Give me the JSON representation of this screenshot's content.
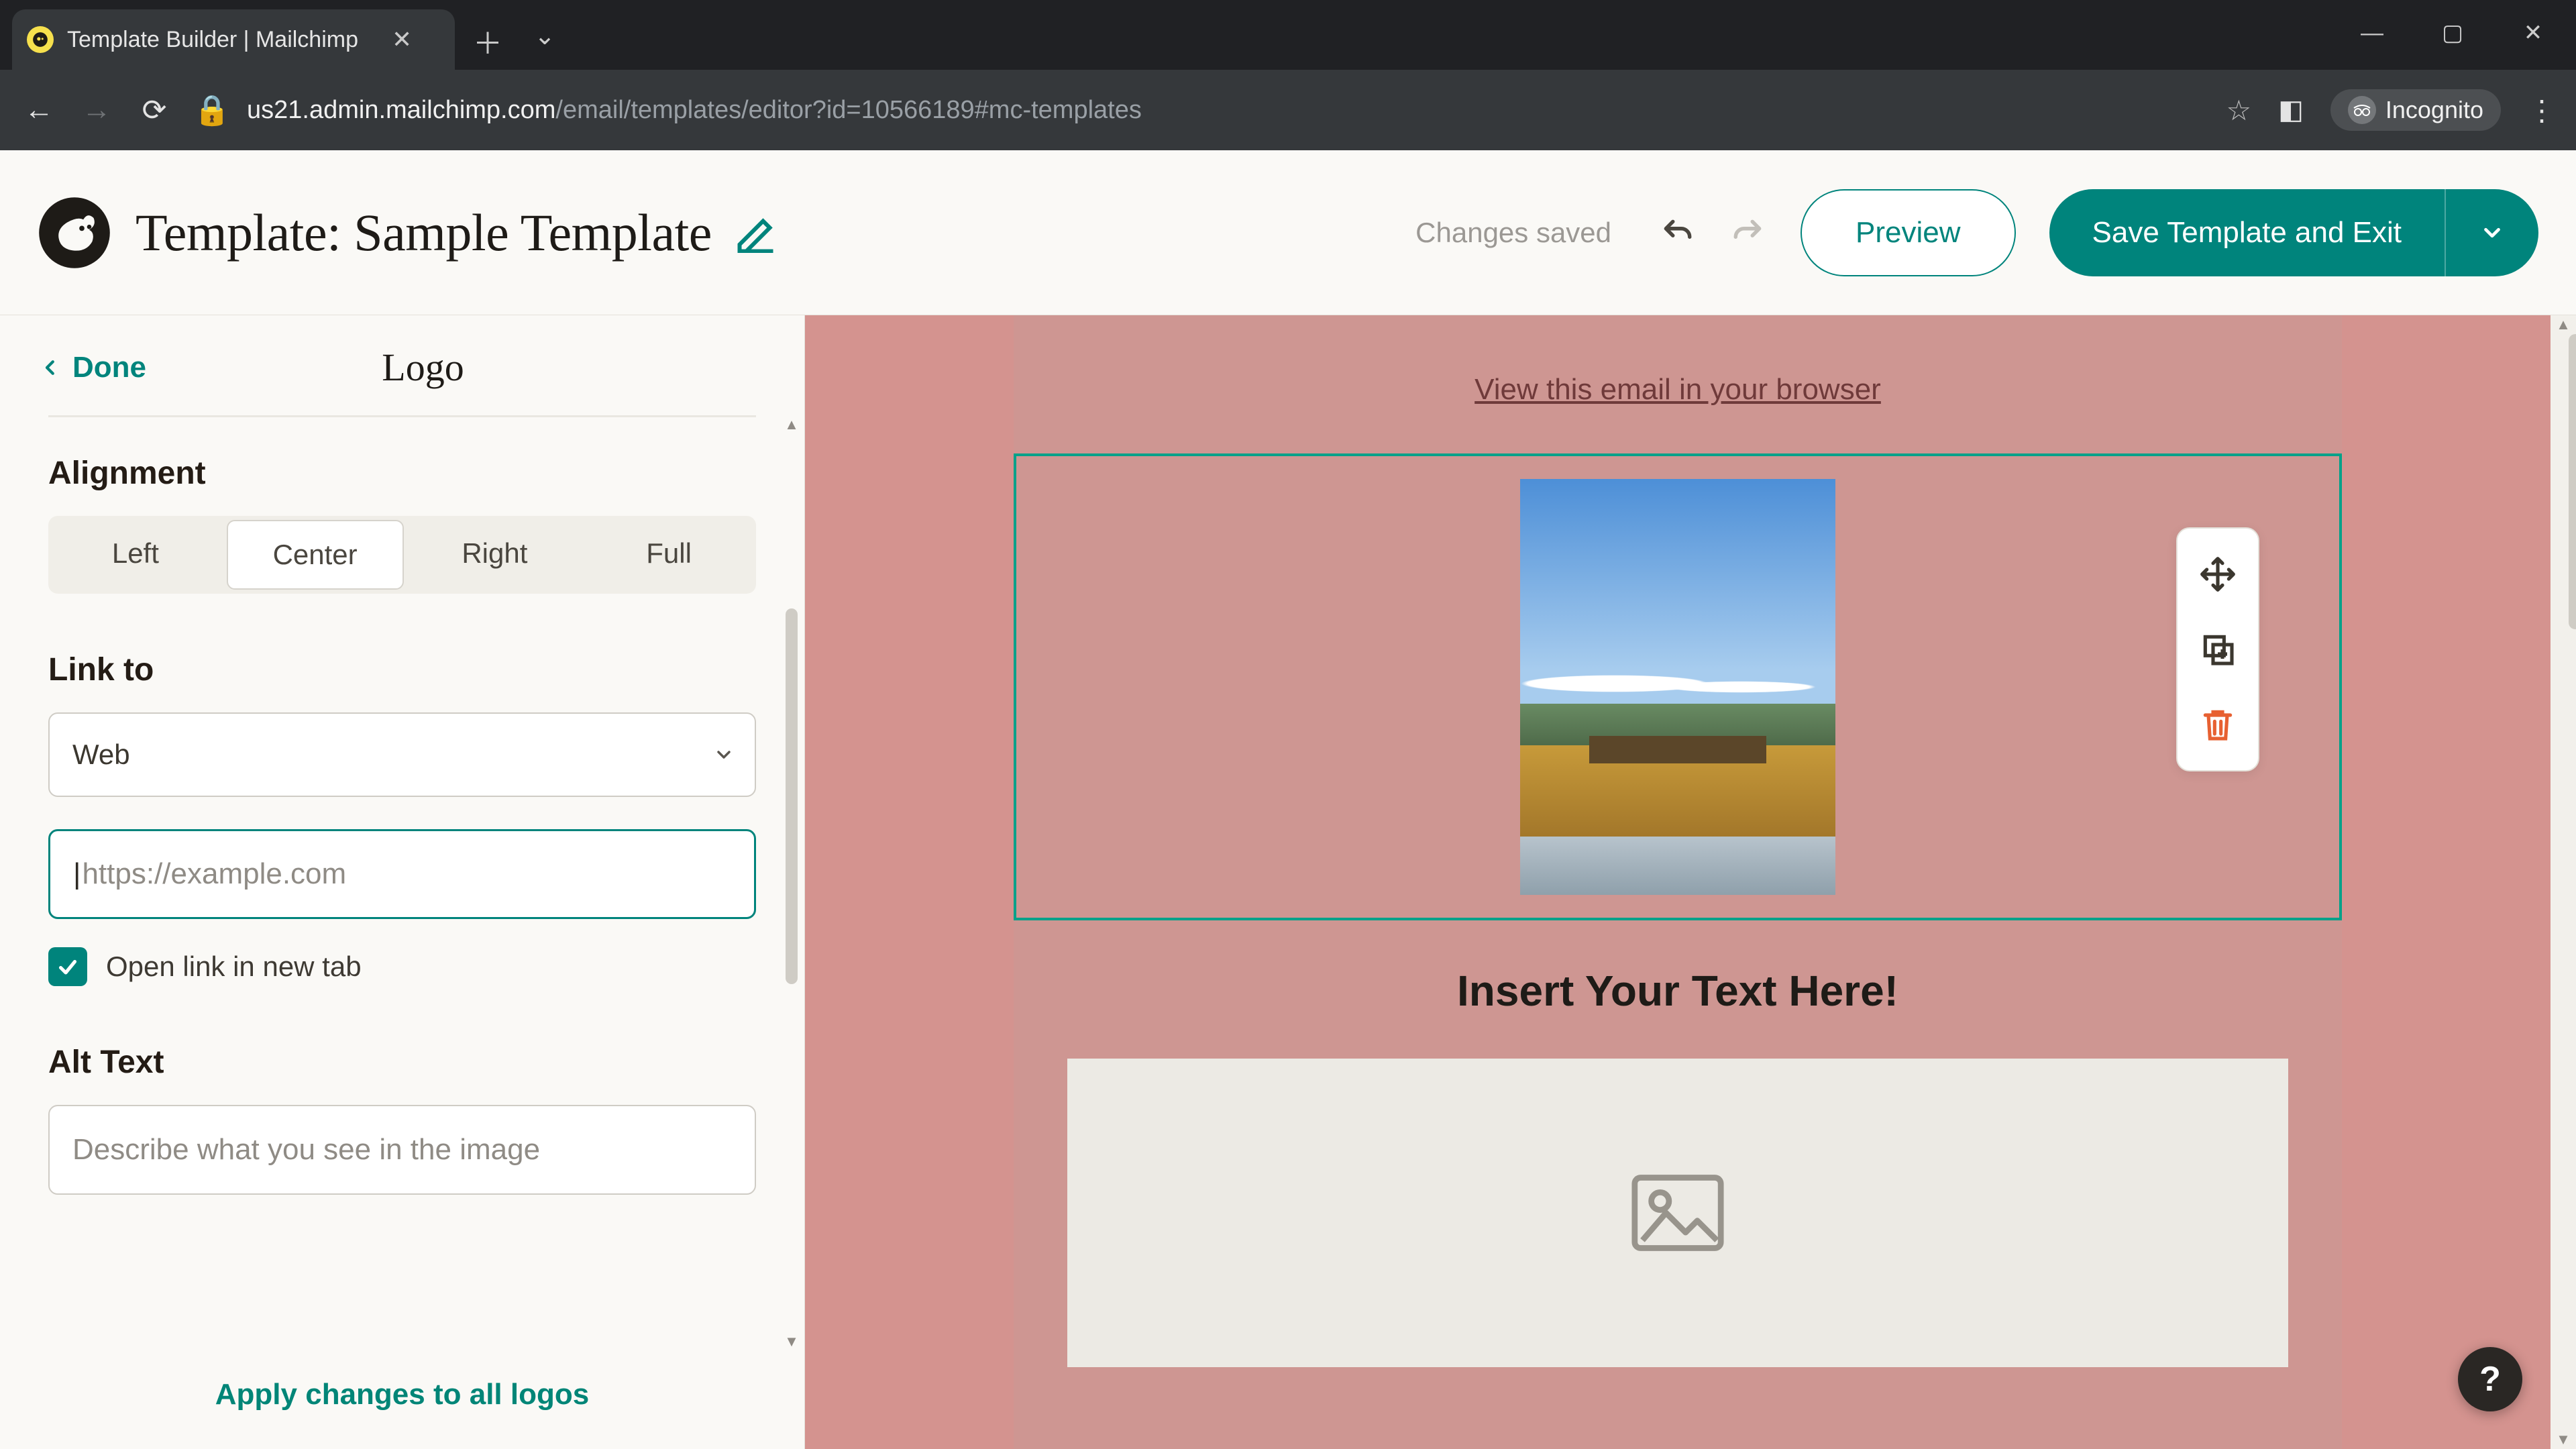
{
  "browser": {
    "tab_title": "Template Builder | Mailchimp",
    "url_host": "us21.admin.mailchimp.com",
    "url_path": "/email/templates/editor?id=10566189#mc-templates",
    "incognito_label": "Incognito"
  },
  "header": {
    "page_title": "Template: Sample Template",
    "status": "Changes saved",
    "preview_label": "Preview",
    "save_label": "Save Template and Exit"
  },
  "sidepanel": {
    "done_label": "Done",
    "title": "Logo",
    "alignment": {
      "label": "Alignment",
      "options": [
        "Left",
        "Center",
        "Right",
        "Full"
      ],
      "selected_index": 1
    },
    "link": {
      "label": "Link to",
      "type_value": "Web",
      "url_value": "",
      "url_placeholder": "https://example.com",
      "open_new_tab_checked": true,
      "open_new_tab_label": "Open link in new tab"
    },
    "alt_text": {
      "label": "Alt Text",
      "value": "",
      "placeholder": "Describe what you see in the image"
    },
    "apply_all_label": "Apply changes to all logos"
  },
  "canvas": {
    "view_browser": "View this email in your browser",
    "heading": "Insert Your Text Here!"
  },
  "help_fab": "?",
  "colors": {
    "teal": "#00847C",
    "selected_border": "#00A189",
    "canvas_bg": "#CE9692"
  }
}
